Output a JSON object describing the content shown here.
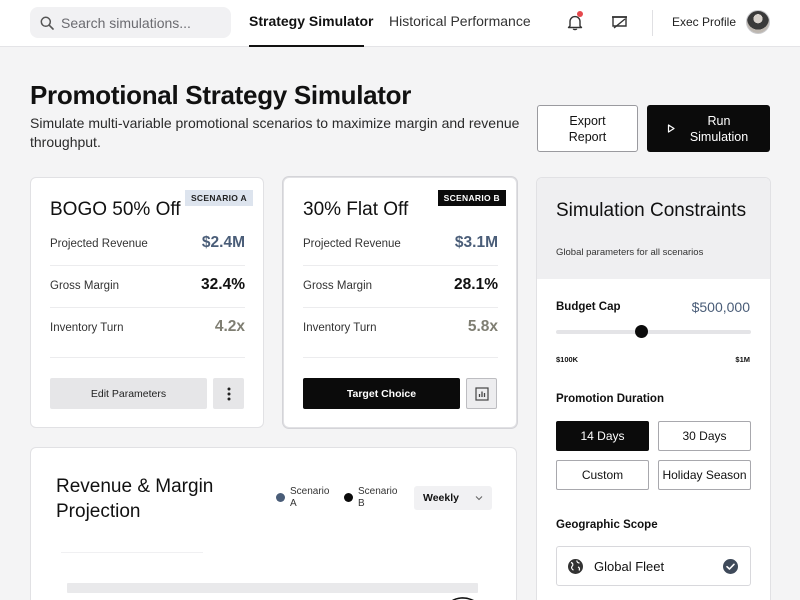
{
  "topbar": {
    "search_placeholder": "Search simulations...",
    "tabs": [
      {
        "label": "Strategy Simulator",
        "active": true
      },
      {
        "label": "Historical Performance",
        "active": false
      }
    ],
    "profile_label": "Exec Profile",
    "icons": [
      "search-icon",
      "bell-icon",
      "present-icon",
      "avatar"
    ]
  },
  "header": {
    "title": "Promotional Strategy Simulator",
    "subtitle": "Simulate multi-variable promotional scenarios to maximize margin and revenue throughput.",
    "export_label": "Export Report",
    "run_label": "Run Simulation"
  },
  "scenarios": [
    {
      "badge": "SCENARIO A",
      "title": "BOGO 50% Off",
      "metrics": [
        {
          "label": "Projected Revenue",
          "value": "$2.4M"
        },
        {
          "label": "Gross Margin",
          "value": "32.4%"
        },
        {
          "label": "Inventory Turn",
          "value": "4.2x"
        }
      ],
      "action_label": "Edit Parameters"
    },
    {
      "badge": "SCENARIO B",
      "title": "30% Flat Off",
      "metrics": [
        {
          "label": "Projected Revenue",
          "value": "$3.1M"
        },
        {
          "label": "Gross Margin",
          "value": "28.1%"
        },
        {
          "label": "Inventory Turn",
          "value": "5.8x"
        }
      ],
      "action_label": "Target Choice"
    }
  ],
  "projection": {
    "title": "Revenue & Margin Projection",
    "legend": [
      {
        "label": "Scenario A",
        "color": "#4a5d78"
      },
      {
        "label": "Scenario B",
        "color": "#0b0b0b"
      }
    ],
    "period_select": "Weekly"
  },
  "constraints": {
    "title": "Simulation Constraints",
    "subtitle": "Global parameters for all scenarios",
    "budget": {
      "label": "Budget Cap",
      "value": "$500,000",
      "min_label": "$100K",
      "max_label": "$1M",
      "level": 0.44
    },
    "duration": {
      "label": "Promotion Duration",
      "options": [
        "14 Days",
        "30 Days",
        "Custom",
        "Holiday Season"
      ],
      "selected": "14 Days"
    },
    "geo": {
      "label": "Geographic Scope",
      "option": "Global Fleet",
      "checked": true
    }
  }
}
